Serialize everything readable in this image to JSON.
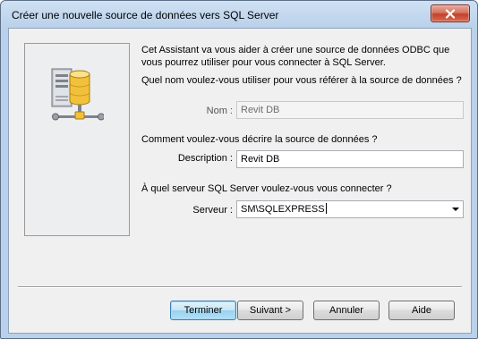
{
  "window": {
    "title": "Créer une nouvelle source de données vers SQL Server",
    "close_icon": "close-icon"
  },
  "wizard": {
    "side_image": "server-database-network-icon",
    "intro": "Cet Assistant va vous aider à créer une source de données ODBC que vous pourrez utiliser pour vous connecter à SQL Server.",
    "name_question": "Quel nom voulez-vous utiliser pour vous référer à la source de données ?",
    "name_label": "Nom :",
    "name_value": "Revit DB",
    "description_question": "Comment voulez-vous décrire la source de données ?",
    "description_label": "Description :",
    "description_value": "Revit DB",
    "server_question": "À quel serveur SQL Server voulez-vous vous connecter ?",
    "server_label": "Serveur :",
    "server_value": "SM\\SQLEXPRESS"
  },
  "buttons": {
    "finish": "Terminer",
    "next": "Suivant >",
    "cancel": "Annuler",
    "help": "Aide"
  }
}
